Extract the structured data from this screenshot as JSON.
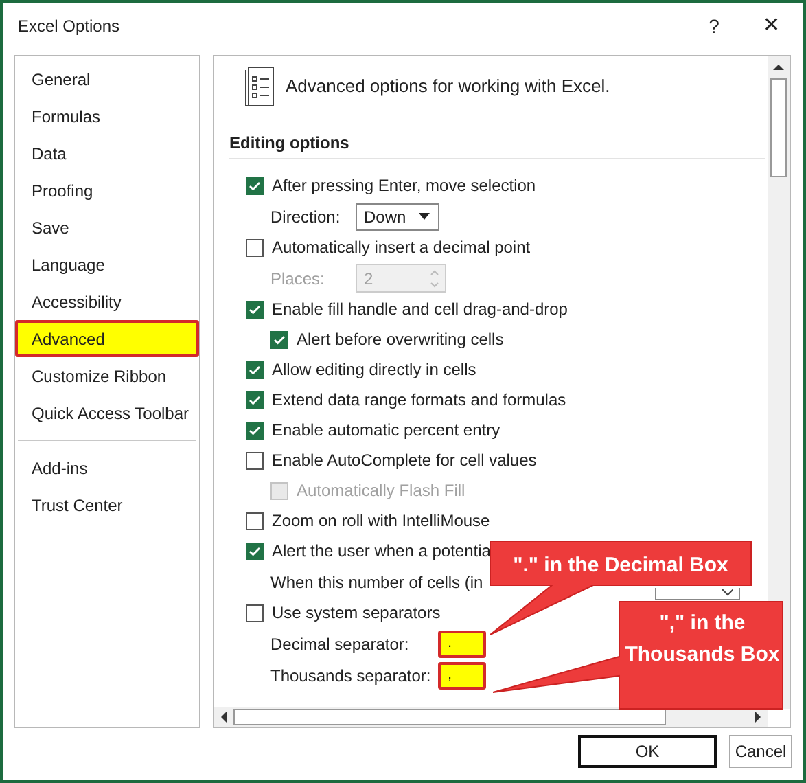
{
  "window": {
    "title": "Excel Options",
    "help": "?",
    "close": "✕"
  },
  "sidebar": {
    "items": [
      {
        "label": "General",
        "selected": false
      },
      {
        "label": "Formulas",
        "selected": false
      },
      {
        "label": "Data",
        "selected": false
      },
      {
        "label": "Proofing",
        "selected": false
      },
      {
        "label": "Save",
        "selected": false
      },
      {
        "label": "Language",
        "selected": false
      },
      {
        "label": "Accessibility",
        "selected": false
      },
      {
        "label": "Advanced",
        "selected": true
      },
      {
        "label": "Customize Ribbon",
        "selected": false
      },
      {
        "label": "Quick Access Toolbar",
        "selected": false
      },
      {
        "kind": "divider"
      },
      {
        "label": "Add-ins",
        "selected": false
      },
      {
        "label": "Trust Center",
        "selected": false
      }
    ]
  },
  "content": {
    "heading": "Advanced options for working with Excel.",
    "section": "Editing options",
    "options": [
      {
        "kind": "checkbox",
        "label": "After pressing Enter, move selection",
        "checked": true,
        "children": [
          {
            "kind": "dropdown",
            "label": "Direction:",
            "value": "Down"
          }
        ]
      },
      {
        "kind": "checkbox",
        "label": "Automatically insert a decimal point",
        "checked": false,
        "children": [
          {
            "kind": "spinner",
            "label": "Places:",
            "value": "2",
            "disabled": true
          }
        ]
      },
      {
        "kind": "checkbox",
        "label": "Enable fill handle and cell drag-and-drop",
        "checked": true,
        "children": [
          {
            "kind": "checkbox",
            "label": "Alert before overwriting cells",
            "checked": true
          }
        ]
      },
      {
        "kind": "checkbox",
        "label": "Allow editing directly in cells",
        "checked": true
      },
      {
        "kind": "checkbox",
        "label": "Extend data range formats and formulas",
        "checked": true
      },
      {
        "kind": "checkbox",
        "label": "Enable automatic percent entry",
        "checked": true
      },
      {
        "kind": "checkbox",
        "label": "Enable AutoComplete for cell values",
        "checked": false,
        "children": [
          {
            "kind": "checkbox",
            "label": "Automatically Flash Fill",
            "checked": false,
            "disabled": true
          }
        ]
      },
      {
        "kind": "checkbox",
        "label": "Zoom on roll with IntelliMouse",
        "checked": false
      },
      {
        "kind": "checkbox",
        "label": "Alert the user when a potentia",
        "checked": true,
        "children": [
          {
            "kind": "number",
            "label": "When this number of cells (in"
          }
        ]
      },
      {
        "kind": "checkbox",
        "label": "Use system separators",
        "checked": false,
        "children": [
          {
            "kind": "text",
            "label": "Decimal separator:",
            "value": ".",
            "highlighted": true
          },
          {
            "kind": "text",
            "label": "Thousands separator:",
            "value": ",",
            "highlighted": true
          }
        ]
      }
    ]
  },
  "callouts": [
    {
      "text": "\".\" in the Decimal Box"
    },
    {
      "text": "\",\" in the Thousands Box"
    }
  ],
  "buttons": [
    {
      "label": "OK",
      "default": true
    },
    {
      "label": "Cancel",
      "default": false
    }
  ]
}
